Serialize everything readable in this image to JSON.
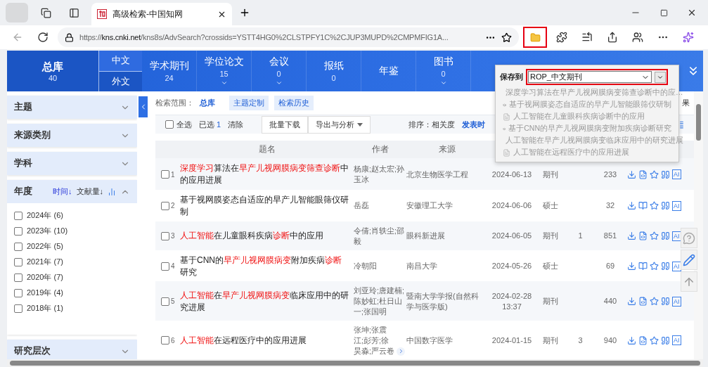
{
  "browser": {
    "tab_title": "高级检索-中国知网",
    "url": {
      "scheme": "https://",
      "host": "kns.cnki.net",
      "path": "/kns8s/AdvSearch?crossids=YSTT4HG0%2CLSTPFY1C%2CJUP3MUPD%2CMPMFIG1A..."
    },
    "folder_highlighted": true
  },
  "nav": {
    "main": {
      "label": "总库",
      "count": "40"
    },
    "langs": [
      {
        "label": "中文",
        "selected": true
      },
      {
        "label": "外文",
        "selected": false
      }
    ],
    "items": [
      {
        "label": "学术期刊",
        "count": "24",
        "has_menu": false
      },
      {
        "label": "学位论文",
        "count": "15",
        "has_menu": true
      },
      {
        "label": "会议",
        "count": "0",
        "has_menu": true
      },
      {
        "label": "报纸",
        "count": "0",
        "has_menu": false
      },
      {
        "label": "年鉴",
        "has_menu": false
      },
      {
        "label": "图书",
        "count": "0",
        "has_menu": true
      }
    ]
  },
  "sidebar": {
    "sections": [
      {
        "title": "主题",
        "expanded": false
      },
      {
        "title": "来源类别",
        "expanded": false
      },
      {
        "title": "学科",
        "expanded": false
      },
      {
        "title": "年度",
        "expanded": true,
        "sort_links": [
          {
            "label": "时间↓",
            "selected": true
          },
          {
            "label": "文献量↓",
            "selected": false
          }
        ],
        "options": [
          {
            "label": "2024年",
            "count": "(6)",
            "checked": false
          },
          {
            "label": "2023年",
            "count": "(10)",
            "checked": false
          },
          {
            "label": "2022年",
            "count": "(5)",
            "checked": false
          },
          {
            "label": "2021年",
            "count": "(7)",
            "checked": false
          },
          {
            "label": "2020年",
            "count": "(7)",
            "checked": false
          },
          {
            "label": "2019年",
            "count": "(4)",
            "checked": false
          },
          {
            "label": "2018年",
            "count": "(1)",
            "checked": false
          }
        ]
      },
      {
        "title": "研究层次",
        "expanded": false
      }
    ]
  },
  "search_scope": {
    "label": "检索范围：",
    "value": "总库",
    "buttons": [
      "主题定制",
      "检索历史"
    ],
    "fragment": "果"
  },
  "toolbar": {
    "select_all": {
      "label": "全选",
      "checked": false
    },
    "selected_label": "已选",
    "selected_count": "1",
    "clear": "清除",
    "buttons": [
      {
        "label": "批量下载",
        "kind": "plain"
      },
      {
        "label": "导出与分析",
        "kind": "menu"
      }
    ],
    "sort_label": "排序：相关度",
    "sort_next": "发表时"
  },
  "table": {
    "columns": [
      "题名",
      "作者",
      "来源"
    ],
    "rows": [
      {
        "number": "1",
        "checked": false,
        "title": [
          {
            "text": "深度学习",
            "hit": true
          },
          {
            "text": "算法在",
            "hit": false
          },
          {
            "text": "早产儿视网膜病变筛查诊断",
            "hit": true
          },
          {
            "text": "中的应用进展",
            "hit": false
          }
        ],
        "authors": "杨康;赵太宏;孙玉冰",
        "source": "北京生物医学工程",
        "date": "2024-06-13",
        "type": "期刊",
        "downloads": "233",
        "kind": "html",
        "ai": "AI"
      },
      {
        "number": "2",
        "checked": false,
        "title": [
          {
            "text": "基于视网膜姿态自适应的早产儿智能眼筛仪研制",
            "hit": false
          }
        ],
        "authors": "岳磊",
        "source": "安徽理工大学",
        "date": "2024-06-06",
        "type": "硕士",
        "downloads": "32",
        "kind": "book",
        "ai": "AI"
      },
      {
        "number": "3",
        "checked": false,
        "title": [
          {
            "text": "人工智能",
            "hit": true
          },
          {
            "text": "在儿童眼科疾病",
            "hit": false
          },
          {
            "text": "诊断",
            "hit": true
          },
          {
            "text": "中的应用",
            "hit": false
          }
        ],
        "authors": "令倩;肖轶尘;邵毅",
        "source": "眼科新进展",
        "date": "2024-06-05",
        "type": "期刊",
        "cited": "1",
        "downloads": "851",
        "kind": "html",
        "ai": "AI"
      },
      {
        "number": "4",
        "checked": false,
        "title": [
          {
            "text": "基于CNN的",
            "hit": false
          },
          {
            "text": "早产儿视网膜病变",
            "hit": true
          },
          {
            "text": "附加疾病",
            "hit": false
          },
          {
            "text": "诊断",
            "hit": true
          },
          {
            "text": "研究",
            "hit": false
          }
        ],
        "authors": "冷朝阳",
        "source": "南昌大学",
        "date": "2024-05-26",
        "type": "硕士",
        "downloads": "69",
        "kind": "book",
        "ai": "AI"
      },
      {
        "number": "5",
        "checked": false,
        "title": [
          {
            "text": "人工智能",
            "hit": true
          },
          {
            "text": "在",
            "hit": false
          },
          {
            "text": "早产儿视网膜病变",
            "hit": true
          },
          {
            "text": "临床应用中的研究进展",
            "hit": false
          }
        ],
        "authors": "刘亚玲;唐建楠;陈妙虹;杜日山一;张国明",
        "source": "暨南大学学报(自然科学与医学版)",
        "date": "2024-02-28",
        "time": "13:37",
        "type": "期刊",
        "downloads": "440",
        "kind": "html",
        "ai": "AI"
      },
      {
        "number": "6",
        "checked": false,
        "title": [
          {
            "text": "人工智能",
            "hit": true
          },
          {
            "text": "在远程医疗中的应用进展",
            "hit": false
          }
        ],
        "authors": "张坤;张震江;彭芳;徐昊淼;严云卷",
        "more_authors": true,
        "source": "中国数字医学",
        "date": "2024-01-15",
        "type": "期刊",
        "cited": "3",
        "downloads": "940",
        "kind": "html",
        "ai": "AI"
      }
    ]
  },
  "save_popup": {
    "label": "保存到",
    "value": "ROP_中文期刊",
    "highlighted": true,
    "items": [
      {
        "kind": "article",
        "title": "深度学习算法在早产儿视网膜病变筛查诊断中的应…"
      },
      {
        "kind": "thesis",
        "title": "基于视网膜姿态自适应的早产儿智能眼筛仪研制"
      },
      {
        "kind": "article",
        "title": "人工智能在儿童眼科疾病诊断中的应用"
      },
      {
        "kind": "thesis",
        "title": "基于CNN的早产儿视网膜病变附加疾病诊断研究"
      },
      {
        "kind": "article",
        "title": "人工智能在早产儿视网膜病变临床应用中的研究进展"
      },
      {
        "kind": "article",
        "title": "人工智能在远程医疗中的应用进展"
      }
    ]
  }
}
